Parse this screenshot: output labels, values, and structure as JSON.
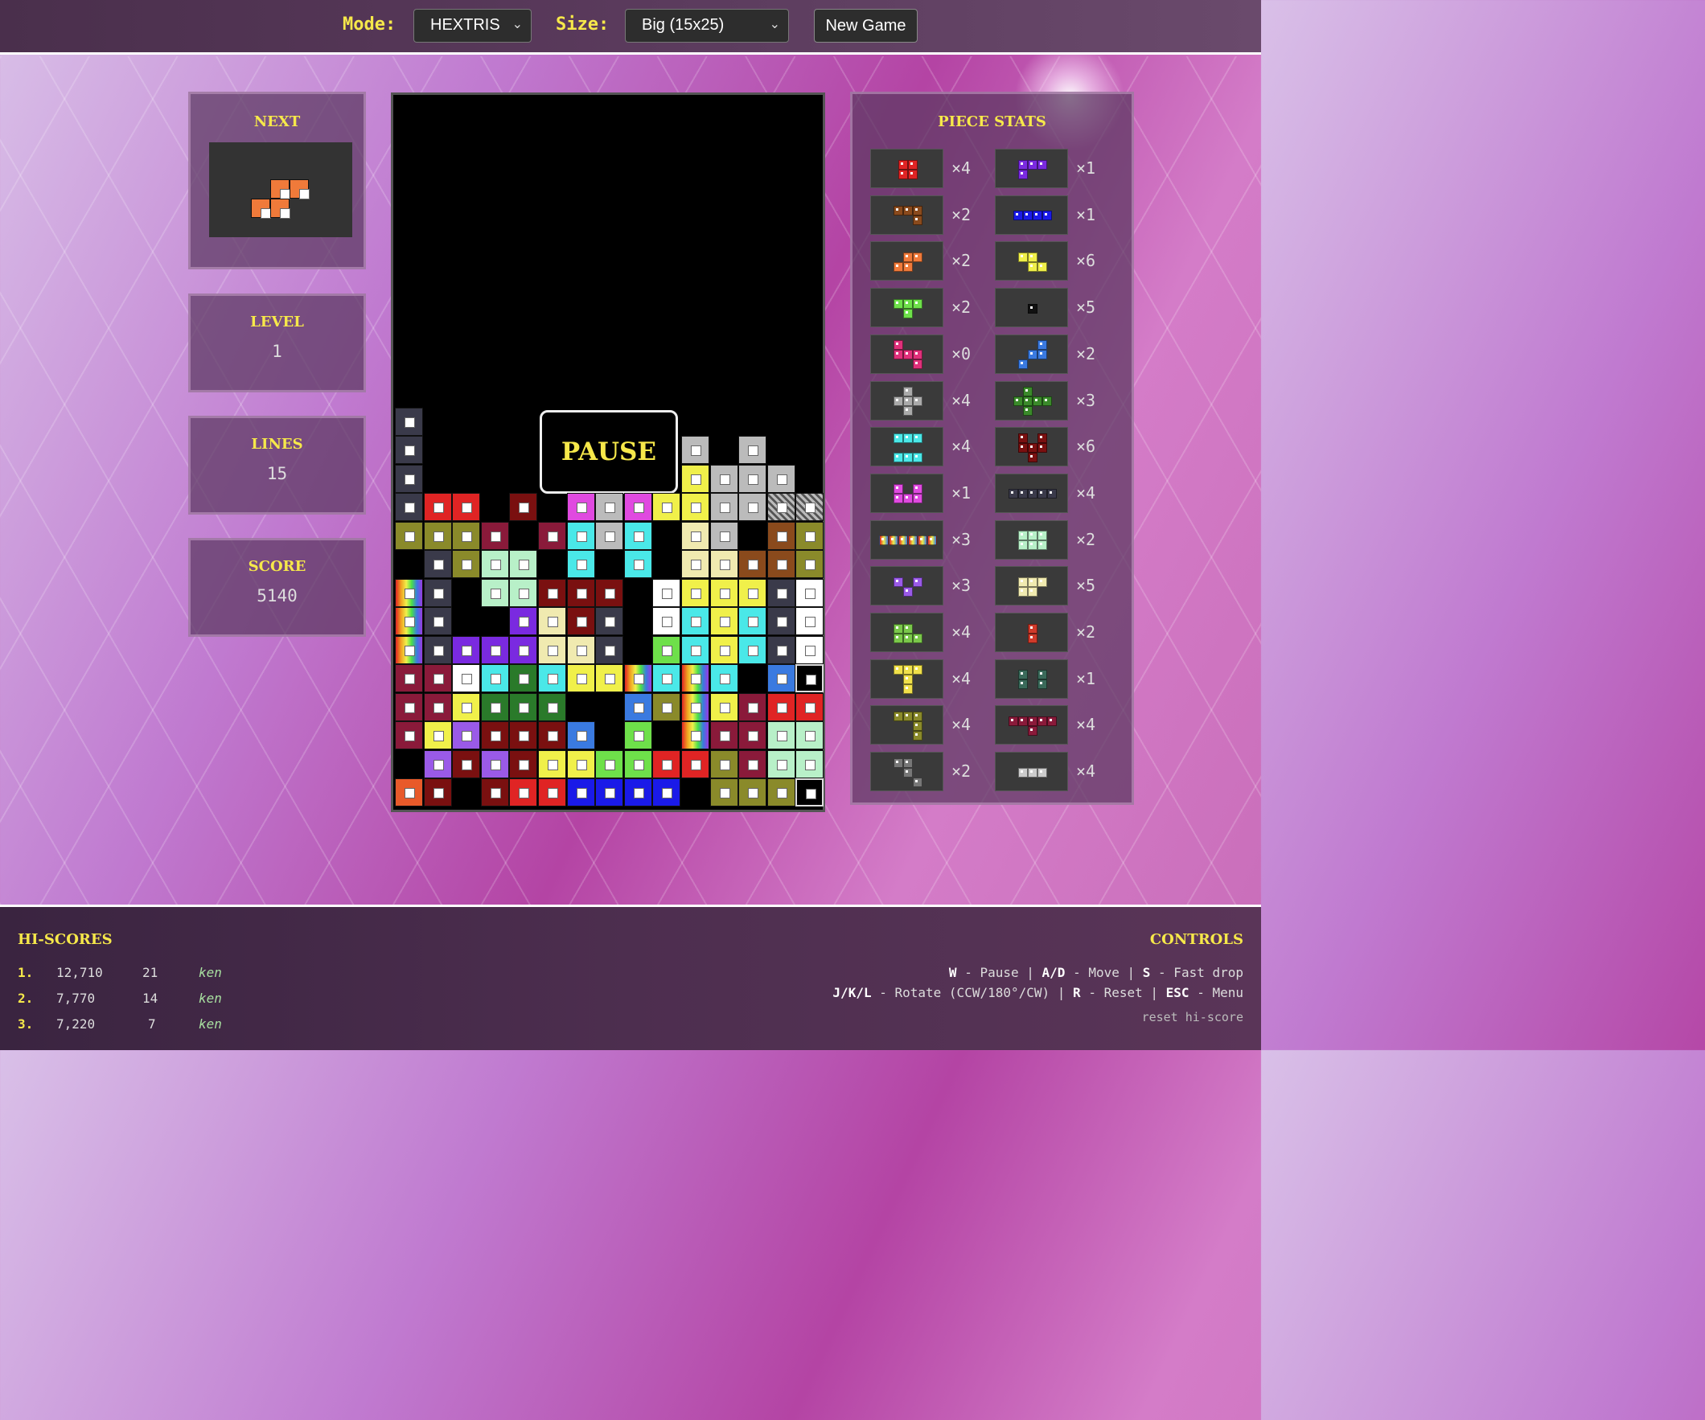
{
  "topbar": {
    "mode_label": "Mode:",
    "mode_value": "HEXTRIS",
    "size_label": "Size:",
    "size_value": "Big (15x25)",
    "new_game_label": "New Game"
  },
  "next": {
    "title": "NEXT"
  },
  "level": {
    "title": "LEVEL",
    "value": "1"
  },
  "lines": {
    "title": "LINES",
    "value": "15"
  },
  "score": {
    "title": "SCORE",
    "value": "5140"
  },
  "board": {
    "pause_label": "PAUSE"
  },
  "piece_stats": {
    "title": "PIECE STATS",
    "left": [
      {
        "count": "×4",
        "color": "#e02424"
      },
      {
        "count": "×2",
        "color": "#8a4a1c"
      },
      {
        "count": "×2",
        "color": "#f07a3a"
      },
      {
        "count": "×2",
        "color": "#6ee04a"
      },
      {
        "count": "×0",
        "color": "#e0307a"
      },
      {
        "count": "×4",
        "color": "#aaaaaa"
      },
      {
        "count": "×4",
        "color": "#4ae8e8"
      },
      {
        "count": "×1",
        "color": "#e04ae0"
      },
      {
        "count": "×3",
        "color": "#rainbow"
      },
      {
        "count": "×3",
        "color": "#9a5ae8"
      },
      {
        "count": "×4",
        "color": "#7ac84a"
      },
      {
        "count": "×4",
        "color": "#f0e04a"
      },
      {
        "count": "×4",
        "color": "#8a8a2a"
      },
      {
        "count": "×2",
        "color": "#777777"
      }
    ],
    "right": [
      {
        "count": "×1",
        "color": "#7a2ae0"
      },
      {
        "count": "×1",
        "color": "#1a1ae8"
      },
      {
        "count": "×6",
        "color": "#f0f04a"
      },
      {
        "count": "×5",
        "color": "#111111"
      },
      {
        "count": "×2",
        "color": "#3a7ae0"
      },
      {
        "count": "×3",
        "color": "#3a8a2a"
      },
      {
        "count": "×6",
        "color": "#7a1010"
      },
      {
        "count": "×4",
        "color": "#3a3a4a"
      },
      {
        "count": "×2",
        "color": "#b8f0c8"
      },
      {
        "count": "×5",
        "color": "#f0eab0"
      },
      {
        "count": "×2",
        "color": "#d03a2a"
      },
      {
        "count": "×1",
        "color": "#3a6a5a"
      },
      {
        "count": "×4",
        "color": "#8a1a3a"
      },
      {
        "count": "×4",
        "color": "#cccccc"
      }
    ]
  },
  "footer": {
    "hiscores_title": "HI-SCORES",
    "hiscores": [
      {
        "rank": "1.",
        "score": "12,710",
        "lines": "21",
        "name": "ken"
      },
      {
        "rank": "2.",
        "score": "7,770",
        "lines": "14",
        "name": "ken"
      },
      {
        "rank": "3.",
        "score": "7,220",
        "lines": "7",
        "name": "ken"
      }
    ],
    "controls_title": "CONTROLS",
    "controls_line1": [
      {
        "key": "W",
        "desc": " - Pause | "
      },
      {
        "key": "A/D",
        "desc": " - Move | "
      },
      {
        "key": "S",
        "desc": " - Fast drop"
      }
    ],
    "controls_line2": [
      {
        "key": "J/K/L",
        "desc": " - Rotate (CCW/180°/CW) | "
      },
      {
        "key": "R",
        "desc": " - Reset | "
      },
      {
        "key": "ESC",
        "desc": " - Menu"
      }
    ],
    "reset_label": "reset hi-score"
  }
}
